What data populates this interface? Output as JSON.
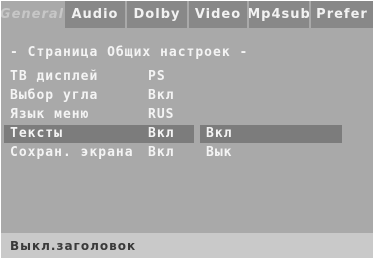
{
  "tabs": [
    {
      "label": "General",
      "active": true
    },
    {
      "label": "Audio",
      "active": false
    },
    {
      "label": "Dolby",
      "active": false
    },
    {
      "label": "Video",
      "active": false
    },
    {
      "label": "Mp4sub",
      "active": false
    },
    {
      "label": "Prefer",
      "active": false
    }
  ],
  "page_title": "- Страница Общих настроек -",
  "settings": [
    {
      "label": "ТВ дисплей",
      "value": "PS"
    },
    {
      "label": "Выбор угла",
      "value": "Вкл"
    },
    {
      "label": "Язык меню",
      "value": "RUS"
    },
    {
      "label": "Тексты",
      "value": "Вкл",
      "selected": true
    },
    {
      "label": "Сохран. экрана",
      "value": "Вкл"
    }
  ],
  "submenu_options": [
    "Вкл",
    "Вык"
  ],
  "status_text": "Выкл.заголовок",
  "colors": {
    "screen_bg": "#a9a9a9",
    "tabbar_bg": "#888888",
    "highlight": "#7c7c7c",
    "text": "#f4f4f4",
    "status_bg": "#c9c9c9",
    "status_text": "#3a3a3a"
  }
}
